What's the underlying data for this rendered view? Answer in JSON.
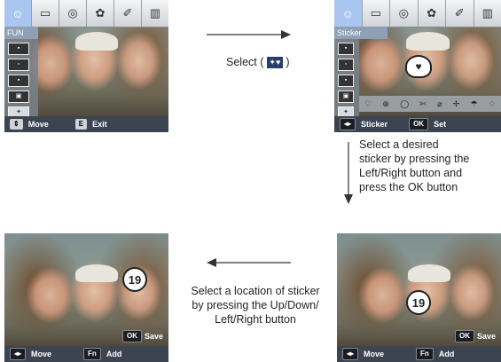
{
  "screen1": {
    "menu_title": "FUN",
    "icons": [
      "fun-face-icon",
      "frame-icon",
      "photo-effect-icon",
      "color-palette-icon",
      "sharpness-icon",
      "piano-icon"
    ],
    "bottom": {
      "move_key": "⇕",
      "move_label": "Move",
      "exit_key": "E",
      "exit_label": "Exit"
    }
  },
  "screen2": {
    "menu_title": "Sticker",
    "stickers": [
      "♡",
      "⊕",
      "◯",
      "✄",
      "⌀",
      "✢",
      "☂",
      "♢"
    ],
    "bottom": {
      "key": "◂▸",
      "label": "Sticker",
      "ok_key": "OK",
      "ok_label": "Set"
    }
  },
  "screen3": {
    "sticker_number": "19",
    "ok_key": "OK",
    "ok_label": "Save",
    "bottom": {
      "move_key": "◂▸",
      "move_label": "Move",
      "fn_key": "Fn",
      "fn_label": "Add"
    }
  },
  "screen4": {
    "sticker_number": "19",
    "ok_key": "OK",
    "ok_label": "Save",
    "bottom": {
      "move_key": "◂▸",
      "move_label": "Move",
      "fn_key": "Fn",
      "fn_label": "Add"
    }
  },
  "captions": {
    "select_before": "Select (",
    "select_after": ")",
    "desired": [
      "Select a desired",
      "sticker by pressing the",
      "Left/Right  button and",
      "press the OK button"
    ],
    "location": [
      "Select a location of sticker",
      "by pressing the Up/Down/",
      "Left/Right button"
    ]
  }
}
